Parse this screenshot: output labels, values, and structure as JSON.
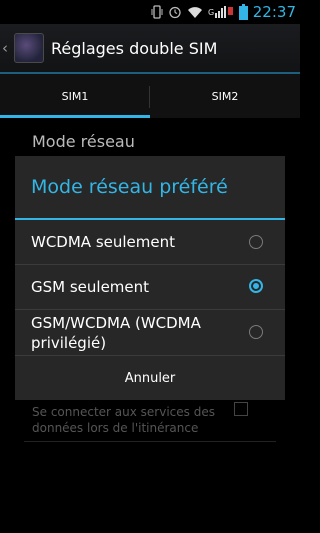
{
  "status_bar": {
    "time": "22:37",
    "icons": [
      "vibrate-icon",
      "alarm-icon",
      "wifi-icon",
      "signal-icon",
      "battery-icon"
    ]
  },
  "action_bar": {
    "title": "Réglages double SIM"
  },
  "tabs": [
    {
      "label": "SIM1",
      "active": true
    },
    {
      "label": "SIM2",
      "active": false
    }
  ],
  "background": {
    "section_title": "Mode réseau",
    "roaming_text": "Se connecter aux services des données lors de l'itinérance"
  },
  "dialog": {
    "title": "Mode réseau préféré",
    "options": [
      {
        "label": "WCDMA seulement",
        "selected": false
      },
      {
        "label": "GSM seulement",
        "selected": true
      },
      {
        "label": "GSM/WCDMA (WCDMA privilégié)",
        "selected": false
      }
    ],
    "cancel_label": "Annuler"
  },
  "colors": {
    "accent": "#33b5e5",
    "dialog_bg": "#272727"
  }
}
